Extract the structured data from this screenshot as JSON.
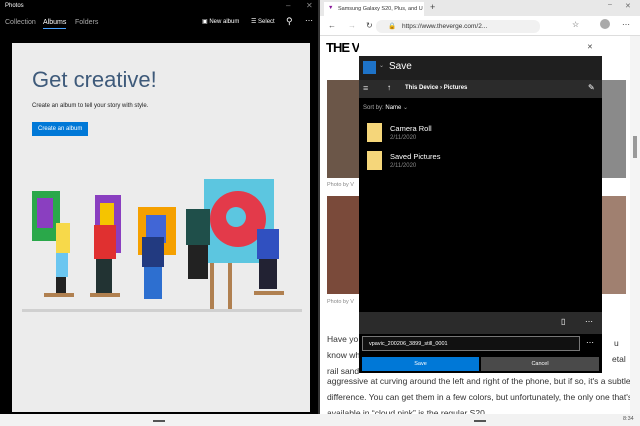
{
  "photos": {
    "title": "Photos",
    "tabs": [
      "Collection",
      "Albums",
      "Folders"
    ],
    "active_tab": "Albums",
    "actions": {
      "new_album": "New album",
      "select": "Select"
    },
    "hero": "Get creative!",
    "subtitle": "Create an album to tell your story with style.",
    "create_button": "Create an album"
  },
  "browser": {
    "tab_title": "Samsung Galaxy S20, Plus, and U",
    "url": "https://www.theverge.com/2...",
    "logo": "THE V",
    "captions": [
      "Photo by V",
      "Photo by V"
    ],
    "article_lines": [
      "Have yo",
      "know wh",
      "rail sand",
      "aggressive at curving around the left and right of the phone, but if so, it's a subtle",
      "difference. You can get them in a few colors, but unfortunately, the only one that's",
      "available in “cloud pink” is the regular S20."
    ],
    "right_fragments": [
      "u",
      "etal"
    ]
  },
  "dialog": {
    "title": "Save",
    "breadcrumb": [
      "This Device",
      "Pictures"
    ],
    "sort_label": "Sort by:",
    "sort_value": "Name",
    "items": [
      {
        "name": "Camera Roll",
        "date": "2/11/2020"
      },
      {
        "name": "Saved Pictures",
        "date": "2/11/2020"
      }
    ],
    "filename": "vpavic_200206_3899_still_0001",
    "save": "Save",
    "cancel": "Cancel"
  },
  "taskbar": {
    "time": "8:34"
  },
  "colors": {
    "accent": "#0078d7",
    "folder": "#f5d67a"
  }
}
